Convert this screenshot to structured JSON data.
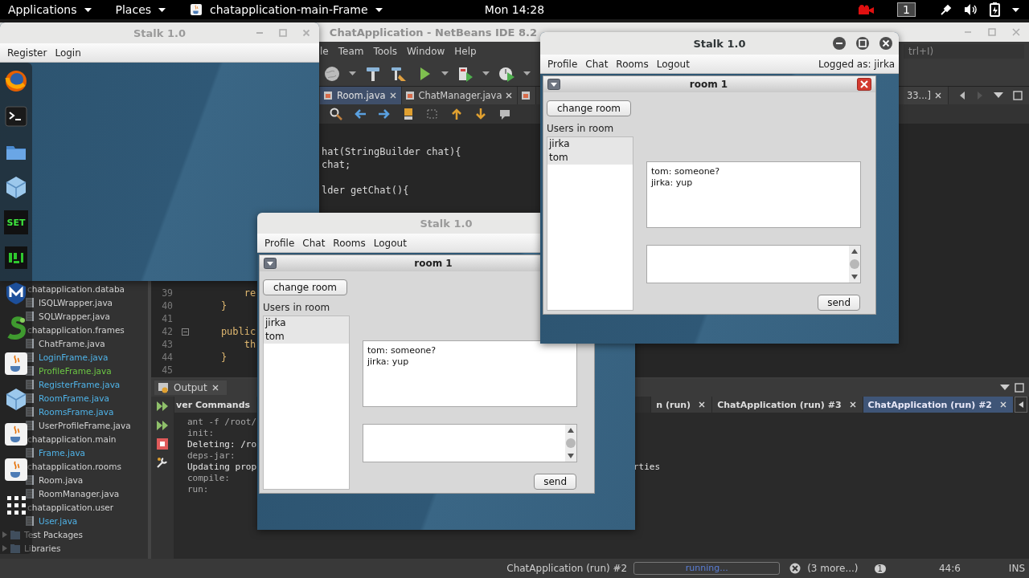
{
  "top_bar": {
    "menus": [
      "Applications",
      "Places"
    ],
    "app_menu": "chatapplication-main-Frame",
    "clock": "Mon 14:28",
    "workspace": "1"
  },
  "ide": {
    "title": "ChatApplication - NetBeans IDE 8.2",
    "menu": [
      "le",
      "Team",
      "Tools",
      "Window",
      "Help"
    ],
    "search": {
      "placeholder": "trl+I)"
    },
    "editor_tabs": [
      {
        "label": "Room.java",
        "selected": true
      },
      {
        "label": "ChatManager.java",
        "selected": false
      },
      {
        "selected": false
      }
    ],
    "editor_tab_right": {
      "label": "33...]",
      "selected": false
    },
    "code_top": "hat(StringBuilder chat){\nchat;\n\nlder getChat(){",
    "code_lines": [
      {
        "number": "39",
        "code": "        re"
      },
      {
        "number": "40",
        "code": "    }"
      },
      {
        "number": "41"
      },
      {
        "number": "42",
        "code": "    public",
        "expanded": true
      },
      {
        "number": "43",
        "code": "        th"
      },
      {
        "number": "44",
        "code": "    }"
      },
      {
        "number": "45"
      }
    ],
    "projects": [
      {
        "children": [
          {
            "label": "chatapplication.databa",
            "children": [
              {
                "label": "ISQLWrapper.java",
                "color": "#d2d2d2"
              },
              {
                "label": "SQLWrapper.java",
                "color": "#d2d2d2"
              }
            ]
          },
          {
            "label": "chatapplication.frames",
            "children": [
              {
                "label": "ChatFrame.java",
                "color": "#d2d2d2"
              },
              {
                "label": "LoginFrame.java",
                "color": "#4fb3e8"
              },
              {
                "label": "ProfileFrame.java",
                "color": "#6cc644"
              },
              {
                "label": "RegisterFrame.java",
                "color": "#4fb3e8"
              },
              {
                "label": "RoomFrame.java",
                "color": "#4fb3e8"
              },
              {
                "label": "RoomsFrame.java",
                "color": "#4fb3e8"
              },
              {
                "label": "UserProfileFrame.java",
                "color": "#d2d2d2"
              }
            ]
          },
          {
            "label": "chatapplication.main",
            "children": [
              {
                "label": "Frame.java",
                "color": "#4fb3e8"
              }
            ]
          },
          {
            "label": "chatapplication.rooms",
            "children": [
              {
                "label": "Room.java",
                "color": "#d2d2d2"
              },
              {
                "label": "RoomManager.java",
                "color": "#d2d2d2"
              }
            ]
          },
          {
            "label": "chatapplication.user",
            "children": [
              {
                "label": "User.java",
                "color": "#4fb3e8"
              }
            ]
          }
        ]
      },
      {
        "label": "Test Packages",
        "expanded": false
      },
      {
        "label": "Libraries",
        "expanded": false
      }
    ],
    "output": {
      "title": "Output",
      "tabs": [
        {
          "label": "ver Commands",
          "selected": false,
          "closable": false
        },
        {
          "label": "n (run)",
          "selected": false,
          "closable": true
        },
        {
          "label": "ChatApplication (run) #3",
          "selected": false,
          "closable": true
        },
        {
          "label": "ChatApplication (run) #2",
          "selected": true,
          "closable": true
        }
      ],
      "console": [
        {
          "kind": "target",
          "text": "ant -f /root/"
        },
        {
          "kind": "target",
          "text": "init:"
        },
        {
          "kind": "message",
          "text": "Deleting: /ro"
        },
        {
          "kind": "target",
          "text": "deps-jar:"
        },
        {
          "kind": "message",
          "text": "Updating prop",
          "end": "rties"
        },
        {
          "kind": "target",
          "text": "compile:"
        },
        {
          "kind": "target",
          "text": "run:"
        }
      ]
    },
    "status": {
      "task": "ChatApplication (run) #2",
      "progress_text": "running...",
      "more": "(3 more...)",
      "notifications": "1",
      "position": "44:6",
      "mode": "INS"
    }
  },
  "windows": [
    {
      "kind": "login",
      "title": "Stalk 1.0",
      "active": false,
      "controls": [
        {
          "kind": "minimize"
        },
        {
          "kind": "maximize"
        },
        {
          "kind": "close"
        }
      ],
      "menu": [
        "Register",
        "Login"
      ]
    },
    {
      "kind": "chat",
      "title": "Stalk 1.0",
      "active": false,
      "menu": [
        "Profile",
        "Chat",
        "Rooms",
        "Logout"
      ],
      "room": {
        "title": "room 1",
        "button": "change room",
        "users_label": "Users in room",
        "users": [
          "jirka",
          "tom"
        ],
        "messages": [
          "tom: someone?",
          "jirka: yup"
        ],
        "send": "send"
      }
    },
    {
      "kind": "chat",
      "title": "Stalk 1.0",
      "active": true,
      "controls": [
        {
          "kind": "minimize"
        },
        {
          "kind": "maximize"
        },
        {
          "kind": "close"
        }
      ],
      "menu": [
        "Profile",
        "Chat",
        "Rooms",
        "Logout"
      ],
      "logged_as": "Logged as: jirka",
      "room": {
        "title": "room 1",
        "closable": true,
        "button": "change room",
        "users_label": "Users in room",
        "users": [
          "jirka",
          "tom"
        ],
        "messages": [
          "tom: someone?",
          "jirka: yup"
        ],
        "send": "send"
      }
    }
  ],
  "dock": [
    {
      "kind": "firefox"
    },
    {
      "kind": "terminal"
    },
    {
      "kind": "files"
    },
    {
      "kind": "cube"
    },
    {
      "kind": "set",
      "label": "SET"
    },
    {
      "kind": "pixel"
    },
    {
      "kind": "shield"
    },
    {
      "kind": "snake"
    },
    {
      "kind": "java"
    },
    {
      "kind": "cube"
    },
    {
      "kind": "java"
    },
    {
      "kind": "java"
    },
    {
      "kind": "grid"
    }
  ]
}
